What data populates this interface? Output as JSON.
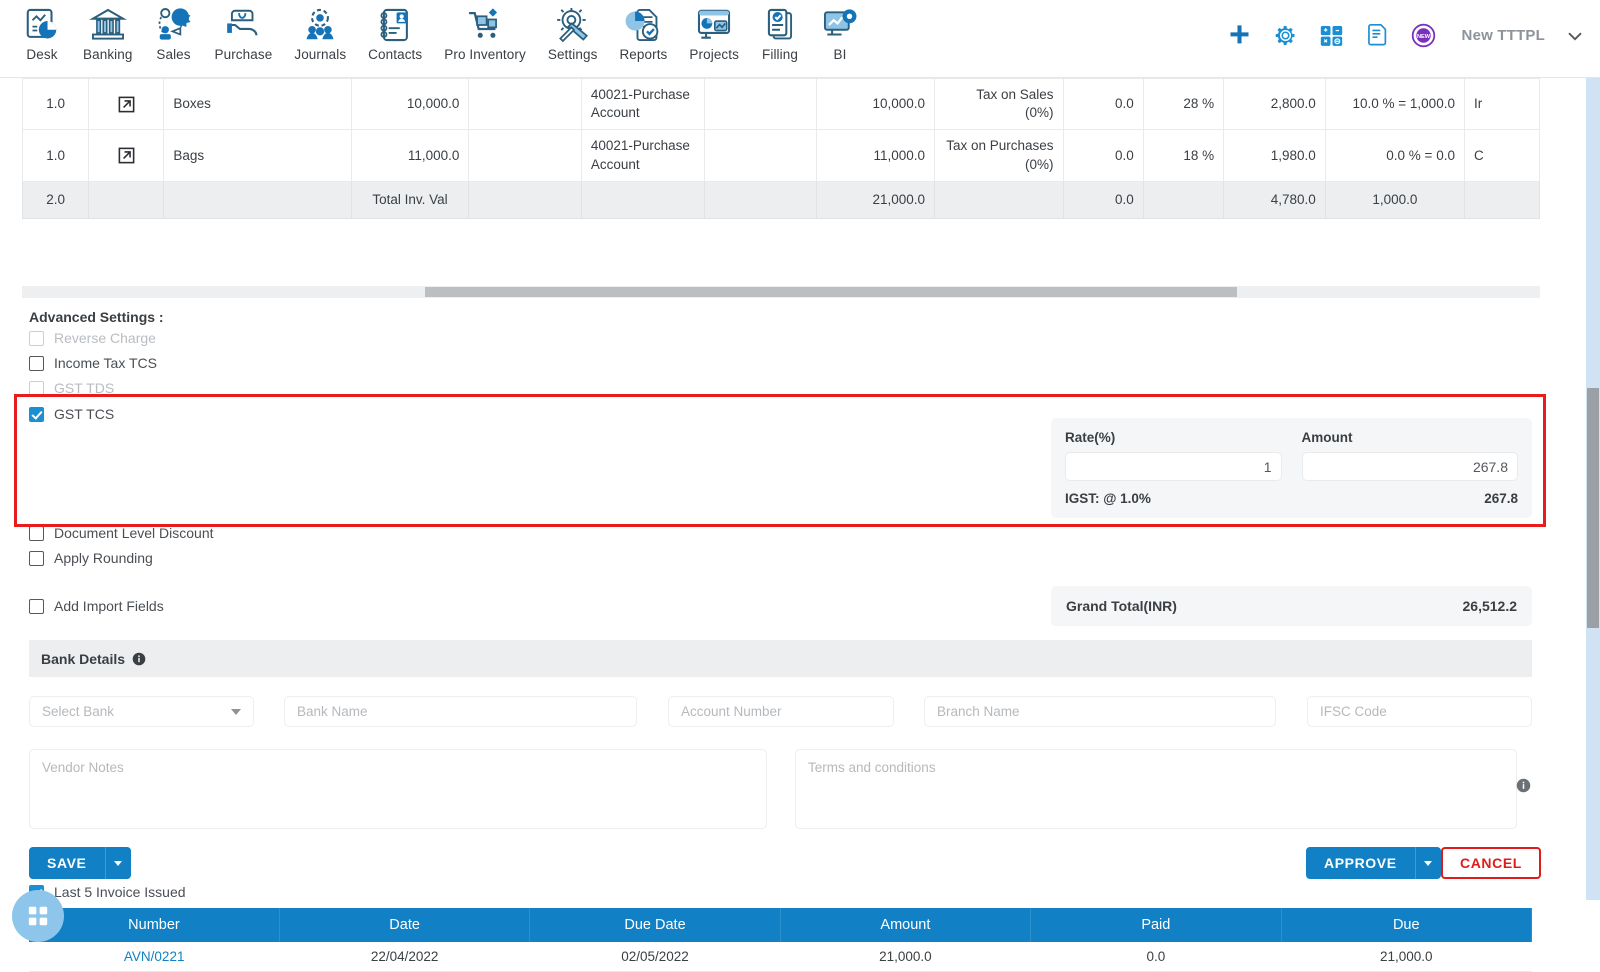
{
  "topnav": {
    "items": [
      {
        "label": "Desk",
        "icon": "dashboard-icon"
      },
      {
        "label": "Banking",
        "icon": "bank-icon"
      },
      {
        "label": "Sales",
        "icon": "sales-icon"
      },
      {
        "label": "Purchase",
        "icon": "purchase-icon"
      },
      {
        "label": "Journals",
        "icon": "journals-icon"
      },
      {
        "label": "Contacts",
        "icon": "contacts-icon"
      },
      {
        "label": "Pro Inventory",
        "icon": "inventory-icon"
      },
      {
        "label": "Settings",
        "icon": "settings-icon"
      },
      {
        "label": "Reports",
        "icon": "reports-icon"
      },
      {
        "label": "Projects",
        "icon": "projects-icon"
      },
      {
        "label": "Filling",
        "icon": "filling-icon"
      },
      {
        "label": "BI",
        "icon": "bi-icon"
      }
    ],
    "actions": [
      {
        "name": "add-icon",
        "glyph": "plus"
      },
      {
        "name": "gear-icon",
        "glyph": "gear"
      },
      {
        "name": "calculator-icon",
        "glyph": "calc"
      },
      {
        "name": "notes-icon",
        "glyph": "notes"
      },
      {
        "name": "new-badge-icon",
        "glyph": "new"
      }
    ],
    "org": "New TTTPL",
    "chevron": "chevron-down-icon"
  },
  "items_table": {
    "rows": [
      {
        "qty": "1.0",
        "open": "external-link-icon",
        "item": "Boxes",
        "rate": "10,000.0",
        "disc": "",
        "account": "40021-Purchase Account",
        "blank": "",
        "amount": "10,000.0",
        "tax": "Tax on Sales (0%)",
        "cess": "0.0",
        "pct": "28 %",
        "tax_amount": "2,800.0",
        "discount": "10.0 % = 1,000.0",
        "end": "Ir"
      },
      {
        "qty": "1.0",
        "open": "external-link-icon",
        "item": "Bags",
        "rate": "11,000.0",
        "disc": "",
        "account": "40021-Purchase Account",
        "blank": "",
        "amount": "11,000.0",
        "tax": "Tax on Purchases (0%)",
        "cess": "0.0",
        "pct": "18 %",
        "tax_amount": "1,980.0",
        "discount": "0.0 % = 0.0",
        "end": "C"
      }
    ],
    "total": {
      "qty": "2.0",
      "label": "Total Inv. Val",
      "amount": "21,000.0",
      "cess": "0.0",
      "tax_amount": "4,780.0",
      "discount": "1,000.0"
    }
  },
  "advanced": {
    "title": "Advanced Settings :",
    "options": [
      {
        "label": "Reverse Charge",
        "checked": false,
        "disabled": true
      },
      {
        "label": "Income Tax TCS",
        "checked": false,
        "disabled": false
      },
      {
        "label": "GST TDS",
        "checked": false,
        "disabled": true
      },
      {
        "label": "GST TCS",
        "checked": true,
        "disabled": false
      },
      {
        "label": "Document Level Discount",
        "checked": false,
        "disabled": false
      },
      {
        "label": "Apply Rounding",
        "checked": false,
        "disabled": false
      },
      {
        "label": "Add Import Fields",
        "checked": false,
        "disabled": false
      }
    ]
  },
  "tcs_panel": {
    "rate_label": "Rate(%)",
    "rate_value": "1",
    "amount_label": "Amount",
    "amount_value": "267.8",
    "breakdown_label": "IGST: @ 1.0%",
    "breakdown_value": "267.8"
  },
  "grand_total": {
    "label": "Grand Total(INR)",
    "value": "26,512.2"
  },
  "bank": {
    "header": "Bank Details",
    "info_icon": "info-icon",
    "select_bank": "Select Bank",
    "bank_name": "Bank Name",
    "account_number": "Account Number",
    "branch_name": "Branch Name",
    "ifsc_code": "IFSC Code"
  },
  "notes": {
    "vendor_notes": "Vendor Notes",
    "terms": "Terms and conditions",
    "info_icon": "info-icon"
  },
  "buttons": {
    "save": "SAVE",
    "approve": "APPROVE",
    "cancel": "CANCEL"
  },
  "last_invoices": {
    "label": "Last 5 Invoice Issued",
    "checked": true,
    "columns": [
      "Number",
      "Date",
      "Due Date",
      "Amount",
      "Paid",
      "Due"
    ],
    "rows": [
      {
        "number": "AVN/0221",
        "date": "22/04/2022",
        "due_date": "02/05/2022",
        "amount": "21,000.0",
        "paid": "0.0",
        "due": "21,000.0"
      }
    ]
  },
  "fab": {
    "icon": "grid-apps-icon"
  },
  "colors": {
    "primary": "#1180c4",
    "highlight": "#e81c1c",
    "header": "#1180c4",
    "panel": "#f5f6f7"
  }
}
